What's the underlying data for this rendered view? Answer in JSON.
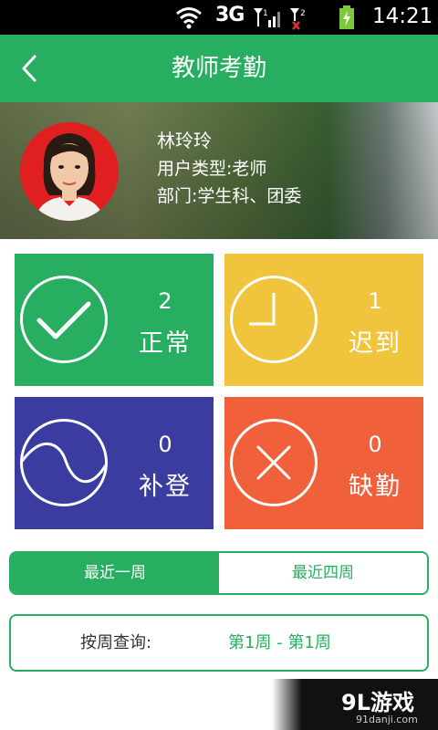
{
  "status_bar": {
    "network": "3G",
    "time": "14:21",
    "icons": [
      "wifi-icon",
      "signal-icon",
      "signal-no-service-icon",
      "battery-charging-icon"
    ]
  },
  "header": {
    "title": "教师考勤",
    "back_icon": "chevron-left-icon",
    "color": "#27ae60"
  },
  "profile": {
    "name": "林玲玲",
    "user_type": "用户类型:老师",
    "department": "部门:学生科、团委"
  },
  "stats": [
    {
      "key": "normal",
      "count": "2",
      "label": "正常",
      "icon": "check-circle-icon",
      "color": "#27ae60"
    },
    {
      "key": "late",
      "count": "1",
      "label": "迟到",
      "icon": "clock-icon",
      "color": "#f0c43d"
    },
    {
      "key": "makeup",
      "count": "0",
      "label": "补登",
      "icon": "wave-circle-icon",
      "color": "#3a3c9f"
    },
    {
      "key": "absent",
      "count": "0",
      "label": "缺勤",
      "icon": "x-circle-icon",
      "color": "#f0603a"
    }
  ],
  "tabs": [
    {
      "label": "最近一周",
      "active": true
    },
    {
      "label": "最近四周",
      "active": false
    }
  ],
  "query": {
    "label": "按周查询:",
    "value": "第1周 - 第1周"
  },
  "watermark": {
    "logo": "9L游戏",
    "url": "91danji.com"
  }
}
